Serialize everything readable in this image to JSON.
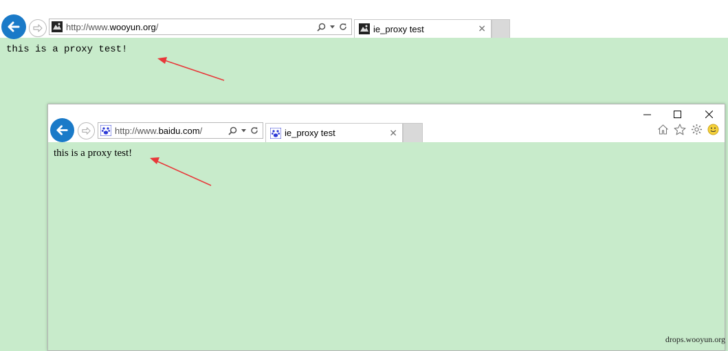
{
  "outer": {
    "address_prefix": "http://www.",
    "address_domain": "wooyun.org",
    "address_suffix": "/",
    "tab_title": "ie_proxy test",
    "page_text": "this is a proxy test!"
  },
  "inner": {
    "address_prefix": "http://www.",
    "address_domain": "baidu.com",
    "address_suffix": "/",
    "tab_title": "ie_proxy test",
    "page_text": "this is a proxy test!"
  },
  "icons": {
    "back": "back-arrow-icon",
    "forward": "forward-arrow-icon",
    "search": "search-icon",
    "dropdown": "dropdown-arrow-icon",
    "refresh": "refresh-icon",
    "close_tab": "close-tab-icon",
    "minimize": "minimize-icon",
    "maximize": "maximize-icon",
    "close_window": "close-window-icon",
    "home": "home-icon",
    "favorites": "star-icon",
    "tools": "gear-icon",
    "feedback": "smiley-icon"
  },
  "colors": {
    "page_background": "#c8ebcb",
    "back_button": "#1a7ac8",
    "annotation_arrow": "#e8383a"
  },
  "watermark": "drops.wooyun.org"
}
